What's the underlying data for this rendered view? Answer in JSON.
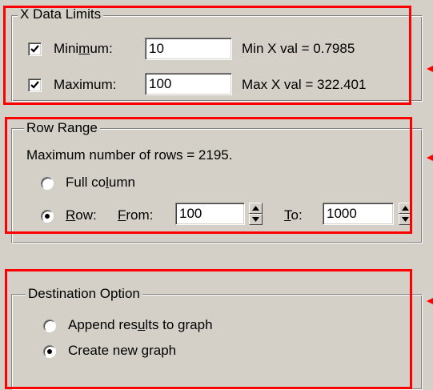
{
  "x_data_limits": {
    "title": "X Data Limits",
    "minimum": {
      "label": "Minimum:",
      "checked": true,
      "value": "10",
      "info": "Min X val = 0.7985"
    },
    "maximum": {
      "label": "Maximum:",
      "checked": true,
      "value": "100",
      "info": "Max X val = 322.401"
    }
  },
  "row_range": {
    "title": "Row Range",
    "max_rows_text": "Maximum number of rows = 2195.",
    "full_column_label": "Full column",
    "row_label": "Row:",
    "selected": "row",
    "from_label": "From:",
    "from_value": "100",
    "to_label": "To:",
    "to_value": "1000"
  },
  "destination_option": {
    "title": "Destination Option",
    "append_label": "Append results to graph",
    "create_label": "Create new graph",
    "selected": "create"
  },
  "annotation": {
    "highlight_color": "#ff0000"
  }
}
